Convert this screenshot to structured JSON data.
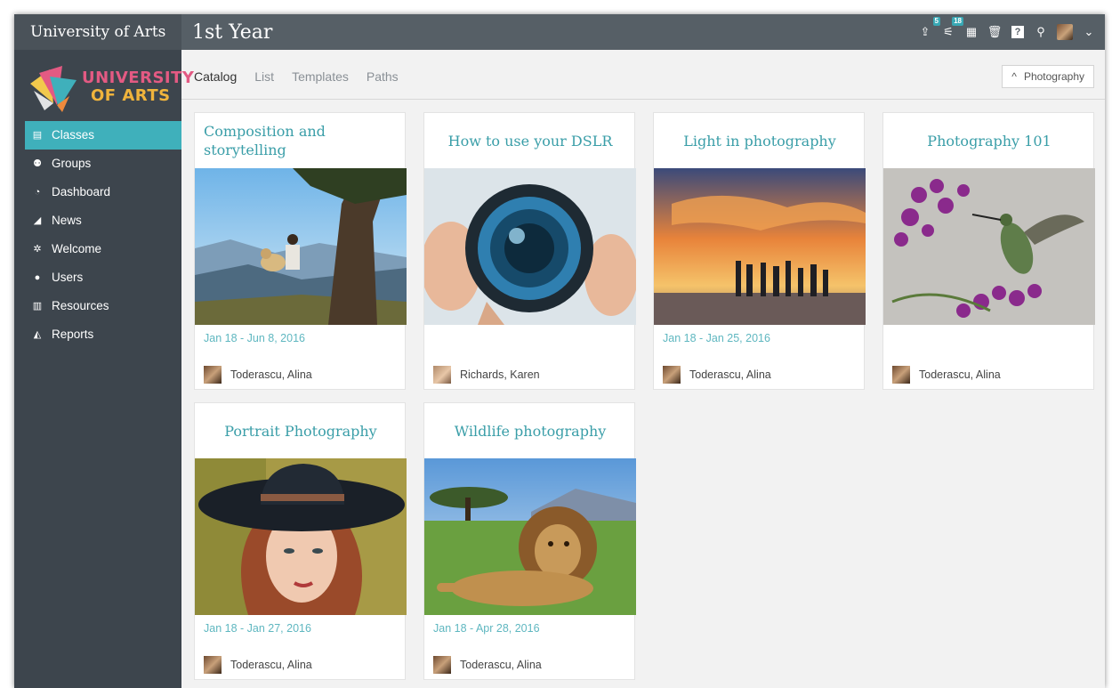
{
  "header": {
    "brand": "University of Arts",
    "page_title": "1st Year",
    "icons": [
      {
        "name": "share-icon",
        "glyph": "⇪",
        "badge": "5"
      },
      {
        "name": "signal-icon",
        "glyph": "⚟",
        "badge": "18"
      },
      {
        "name": "calendar-icon",
        "glyph": "▦",
        "badge": ""
      },
      {
        "name": "trash-icon",
        "glyph": "🗑",
        "badge": ""
      },
      {
        "name": "help-icon",
        "glyph": "?",
        "badge": ""
      },
      {
        "name": "search-icon",
        "glyph": "⚲",
        "badge": ""
      }
    ],
    "profile_chevron": "⌄"
  },
  "logo": {
    "line1": "UNIVERSITY",
    "line2": "OF ARTS"
  },
  "sidebar": {
    "items": [
      {
        "label": "Classes",
        "icon": "book-icon",
        "glyph": "▤",
        "active": true
      },
      {
        "label": "Groups",
        "icon": "groups-icon",
        "glyph": "⚉",
        "active": false
      },
      {
        "label": "Dashboard",
        "icon": "dashboard-icon",
        "glyph": "◔",
        "active": false
      },
      {
        "label": "News",
        "icon": "megaphone-icon",
        "glyph": "◢",
        "active": false
      },
      {
        "label": "Welcome",
        "icon": "welcome-icon",
        "glyph": "✲",
        "active": false
      },
      {
        "label": "Users",
        "icon": "user-icon",
        "glyph": "●",
        "active": false
      },
      {
        "label": "Resources",
        "icon": "resources-icon",
        "glyph": "▥",
        "active": false
      },
      {
        "label": "Reports",
        "icon": "reports-icon",
        "glyph": "◭",
        "active": false
      }
    ]
  },
  "tabs": [
    {
      "label": "Catalog",
      "active": true
    },
    {
      "label": "List",
      "active": false
    },
    {
      "label": "Templates",
      "active": false
    },
    {
      "label": "Paths",
      "active": false
    }
  ],
  "filter": {
    "label": "Photography",
    "chevron": "^"
  },
  "cards": [
    {
      "title": "Composition and storytelling",
      "dates": "Jan 18 - Jun 8, 2016",
      "owner": "Toderascu, Alina"
    },
    {
      "title": "How to use your DSLR",
      "dates": "",
      "owner": "Richards, Karen"
    },
    {
      "title": "Light in photography",
      "dates": "Jan 18 - Jan 25, 2016",
      "owner": "Toderascu, Alina"
    },
    {
      "title": "Photography 101",
      "dates": "",
      "owner": "Toderascu, Alina"
    },
    {
      "title": "Portrait Photography",
      "dates": "Jan 18 - Jan 27, 2016",
      "owner": "Toderascu, Alina"
    },
    {
      "title": "Wildlife photography",
      "dates": "Jan 18 - Apr 28, 2016",
      "owner": "Toderascu, Alina"
    }
  ]
}
